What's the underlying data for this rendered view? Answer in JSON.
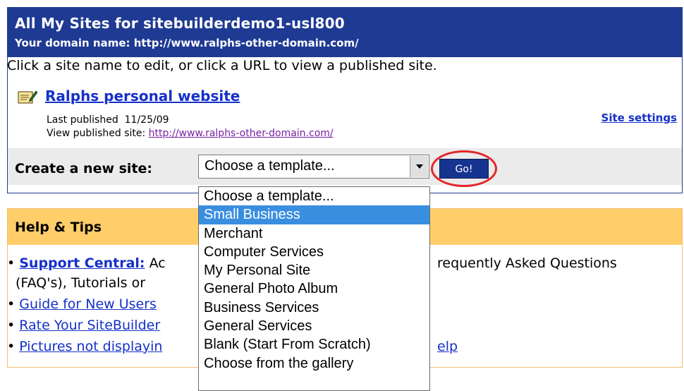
{
  "header": {
    "title": "All My Sites for sitebuilderdemo1-usl800",
    "domain_line": "Your domain name: http://www.ralphs-other-domain.com/"
  },
  "instruction": "Click a site name to edit, or click a URL to view a published site.",
  "site": {
    "name": "Ralphs personal website",
    "icon": "notepad-edit-icon",
    "last_published_label": "Last published",
    "last_published_date": "11/25/09",
    "view_label": "View published site:",
    "url": "http://www.ralphs-other-domain.com/",
    "settings_link": "Site settings"
  },
  "create": {
    "label": "Create a new site:",
    "selected_value": "Choose a template...",
    "go_label": "Go!",
    "options": [
      "Choose a template...",
      "Small Business",
      "Merchant",
      "Computer Services",
      "My Personal Site",
      "General Photo Album",
      "Business Services",
      "General Services",
      "Blank (Start From Scratch)",
      "Choose from the gallery"
    ],
    "highlighted_option": "Small Business"
  },
  "help": {
    "title": "Help & Tips",
    "bullets": [
      {
        "link": "Support Central:",
        "text": " Ac"
      },
      {
        "text": "(FAQ's), Tutorials or"
      },
      {
        "link": "Guide for New Users"
      },
      {
        "link": "Rate Your SiteBuilder"
      },
      {
        "link": "Pictures not displayin"
      }
    ],
    "right_fragments": {
      "faq": "requently Asked Questions",
      "help": "elp"
    }
  },
  "colors": {
    "header_bg": "#1f3a93",
    "tips_header_bg": "#ffce6b",
    "link": "#1530c9",
    "highlight_ring": "#e3262a",
    "selected_option_bg": "#3a8ee0"
  }
}
